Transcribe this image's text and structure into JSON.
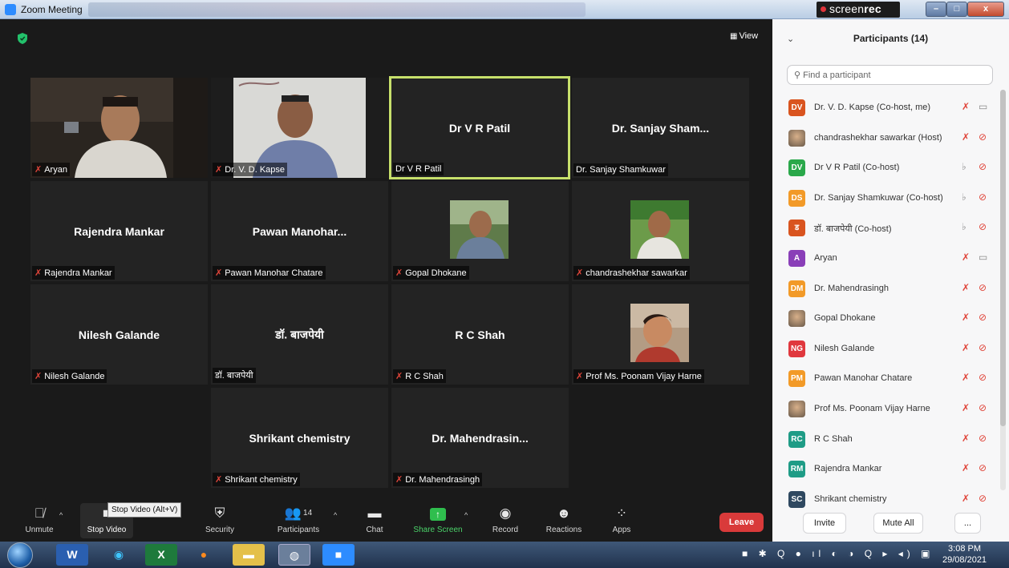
{
  "window": {
    "title": "Zoom Meeting"
  },
  "recorder": {
    "brand_light": "screen",
    "brand_bold": "rec"
  },
  "view_label": "View",
  "tiles": [
    {
      "big": "",
      "label": "Aryan",
      "muted": true
    },
    {
      "big": "",
      "label": "Dr. V. D. Kapse",
      "muted": true
    },
    {
      "big": "Dr V R Patil",
      "label": "Dr V R Patil",
      "muted": false
    },
    {
      "big": "Dr. Sanjay Sham...",
      "label": "Dr. Sanjay Shamkuwar",
      "muted": false
    },
    {
      "big": "Rajendra Mankar",
      "label": "Rajendra Mankar",
      "muted": true
    },
    {
      "big": "Pawan Manohar...",
      "label": "Pawan Manohar Chatare",
      "muted": true
    },
    {
      "big": "",
      "label": "Gopal Dhokane",
      "muted": true
    },
    {
      "big": "",
      "label": "chandrashekhar sawarkar",
      "muted": true
    },
    {
      "big": "Nilesh Galande",
      "label": "Nilesh Galande",
      "muted": true
    },
    {
      "big": "डॉ. बाजपेयी",
      "label": "डॉ. बाजपेयी",
      "muted": false
    },
    {
      "big": "R C Shah",
      "label": "R C Shah",
      "muted": true
    },
    {
      "big": "",
      "label": "Prof Ms. Poonam Vijay Harne",
      "muted": true
    },
    {
      "big": "Shrikant chemistry",
      "label": "Shrikant chemistry",
      "muted": true
    },
    {
      "big": "Dr. Mahendrasin...",
      "label": "Dr. Mahendrasingh",
      "muted": true
    }
  ],
  "toolbar": {
    "unmute": "Unmute",
    "stop_video": "Stop Video",
    "tooltip": "Stop Video (Alt+V)",
    "security": "Security",
    "participants": "Participants",
    "participants_count": "14",
    "chat": "Chat",
    "share_screen": "Share Screen",
    "record": "Record",
    "reactions": "Reactions",
    "apps": "Apps",
    "leave": "Leave"
  },
  "panel": {
    "title": "Participants (14)",
    "search_placeholder": "Find a participant",
    "participants": [
      {
        "initials": "DV",
        "color": "#d9541f",
        "name": "Dr. V. D. Kapse (Co-host, me)",
        "photo": false,
        "mic": "muted",
        "video": "on"
      },
      {
        "initials": "",
        "color": "#8a6a50",
        "name": "chandrashekhar sawarkar (Host)",
        "photo": true,
        "mic": "muted",
        "video": "off"
      },
      {
        "initials": "DV",
        "color": "#2aa84a",
        "name": "Dr V R Patil (Co-host)",
        "photo": false,
        "mic": "on",
        "video": "off"
      },
      {
        "initials": "DS",
        "color": "#f29a28",
        "name": "Dr. Sanjay Shamkuwar (Co-host)",
        "photo": false,
        "mic": "on",
        "video": "off"
      },
      {
        "initials": "ड",
        "color": "#d9541f",
        "name": "डॉ. बाजपेयी (Co-host)",
        "photo": false,
        "mic": "on",
        "video": "off"
      },
      {
        "initials": "A",
        "color": "#8a3fb8",
        "name": "Aryan",
        "photo": false,
        "mic": "muted",
        "video": "on"
      },
      {
        "initials": "DM",
        "color": "#f29a28",
        "name": "Dr. Mahendrasingh",
        "photo": false,
        "mic": "muted",
        "video": "off"
      },
      {
        "initials": "",
        "color": "#6a5a4a",
        "name": "Gopal Dhokane",
        "photo": true,
        "mic": "muted",
        "video": "off"
      },
      {
        "initials": "NG",
        "color": "#e0383e",
        "name": "Nilesh Galande",
        "photo": false,
        "mic": "muted",
        "video": "off"
      },
      {
        "initials": "PM",
        "color": "#f29a28",
        "name": "Pawan Manohar Chatare",
        "photo": false,
        "mic": "muted",
        "video": "off"
      },
      {
        "initials": "",
        "color": "#7a4a3a",
        "name": "Prof Ms. Poonam Vijay Harne",
        "photo": true,
        "mic": "muted",
        "video": "off"
      },
      {
        "initials": "RC",
        "color": "#1f9c86",
        "name": "R C Shah",
        "photo": false,
        "mic": "muted",
        "video": "off"
      },
      {
        "initials": "RM",
        "color": "#1f9c86",
        "name": "Rajendra Mankar",
        "photo": false,
        "mic": "muted",
        "video": "off"
      },
      {
        "initials": "SC",
        "color": "#2f4860",
        "name": "Shrikant chemistry",
        "photo": false,
        "mic": "muted",
        "video": "off"
      }
    ],
    "invite": "Invite",
    "mute_all": "Mute All",
    "more": "..."
  },
  "taskbar": {
    "time": "3:08 PM",
    "date": "29/08/2021"
  }
}
